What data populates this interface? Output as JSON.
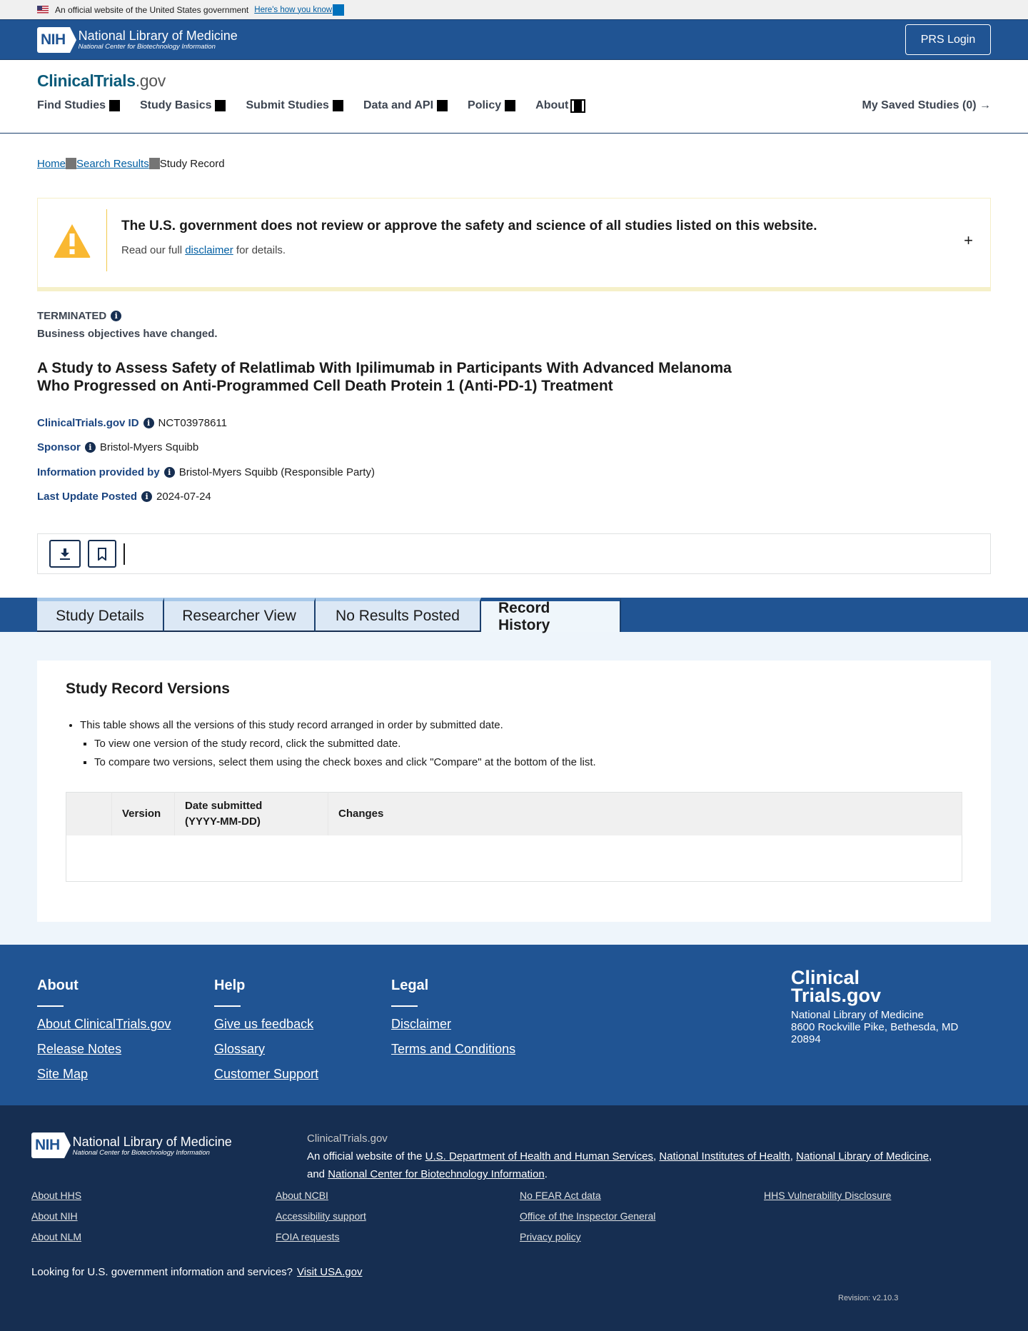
{
  "gov_banner": {
    "text": "An official website of the United States government",
    "link": "Here's how you know"
  },
  "nih_header": {
    "badge": "NIH",
    "title": "National Library of Medicine",
    "subtitle": "National Center for Biotechnology Information",
    "prs_login": "PRS Login"
  },
  "site": {
    "logo_main": "ClinicalTrials",
    "logo_suffix": ".gov",
    "nav": [
      {
        "label": "Find Studies"
      },
      {
        "label": "Study Basics"
      },
      {
        "label": "Submit Studies"
      },
      {
        "label": "Data and API"
      },
      {
        "label": "Policy"
      },
      {
        "label": "About"
      }
    ],
    "saved_studies": "My Saved Studies (0)",
    "saved_arrow": "→"
  },
  "breadcrumb": {
    "items": [
      "Home",
      "Search Results"
    ],
    "current": "Study Record"
  },
  "alert": {
    "title": "The U.S. government does not review or approve the safety and science of all studies listed on this website.",
    "sub_prefix": "Read our full ",
    "sub_link": "disclaimer",
    "sub_suffix": " for details.",
    "expand": "+"
  },
  "study": {
    "status": "TERMINATED",
    "reason": "Business objectives have changed.",
    "title_line1": "A Study to Assess Safety of Relatlimab With Ipilimumab in Participants With Advanced Melanoma",
    "title_line2": "Who Progressed on Anti-Programmed Cell Death Protein 1 (Anti-PD-1) Treatment",
    "meta": [
      {
        "label": "ClinicalTrials.gov ID",
        "value": "NCT03978611"
      },
      {
        "label": "Sponsor",
        "value": "Bristol-Myers Squibb"
      },
      {
        "label": "Information provided by",
        "value": "Bristol-Myers Squibb (Responsible Party)"
      },
      {
        "label": "Last Update Posted",
        "value": "2024-07-24"
      }
    ]
  },
  "tabs": [
    {
      "label": "Study Details",
      "active": false
    },
    {
      "label": "Researcher View",
      "active": false
    },
    {
      "label": "No Results Posted",
      "active": false
    },
    {
      "label": "Record History",
      "active": true
    }
  ],
  "record_history": {
    "heading": "Study Record Versions",
    "bullet_main": "This table shows all the versions of this study record arranged in order by submitted date.",
    "bullet_sub": [
      "To view one version of the study record, click the submitted date.",
      "To compare two versions, select them using the check boxes and click \"Compare\" at the bottom of the list."
    ],
    "table": {
      "columns": [
        "",
        "Version",
        "Date submitted",
        "(YYYY-MM-DD)",
        "Changes"
      ],
      "rows": []
    }
  },
  "footer": {
    "columns": [
      {
        "heading": "About",
        "links": [
          "About ClinicalTrials.gov",
          "Release Notes",
          "Site Map"
        ]
      },
      {
        "heading": "Help",
        "links": [
          "Give us feedback",
          "Glossary",
          "Customer Support"
        ]
      },
      {
        "heading": "Legal",
        "links": [
          "Disclaimer",
          "Terms and Conditions"
        ]
      }
    ],
    "brand_line1": "Clinical",
    "brand_line2": "Trials.gov",
    "address_line1": "National Library of Medicine",
    "address_line2": "8600 Rockville Pike, Bethesda, MD",
    "address_line3": "20894"
  },
  "footer2": {
    "nih_badge": "NIH",
    "nih_title": "National Library of Medicine",
    "nih_subtitle": "National Center for Biotechnology Information",
    "site_name": "ClinicalTrials.gov",
    "official_prefix": "An official website of the ",
    "official_links": [
      "U.S. Department of Health and Human Services",
      "National Institutes of Health",
      "National Library of Medicine",
      "National Center for Biotechnology Information"
    ],
    "links": [
      "About HHS",
      "About NCBI",
      "No FEAR Act data",
      "HHS Vulnerability Disclosure",
      "About NIH",
      "Accessibility support",
      "Office of the Inspector General",
      "",
      "About NLM",
      "FOIA requests",
      "Privacy policy",
      ""
    ],
    "usa_text": "Looking for U.S. government information and services?",
    "usa_link": "Visit USA.gov",
    "revision": "Revision: v2.10.3"
  }
}
